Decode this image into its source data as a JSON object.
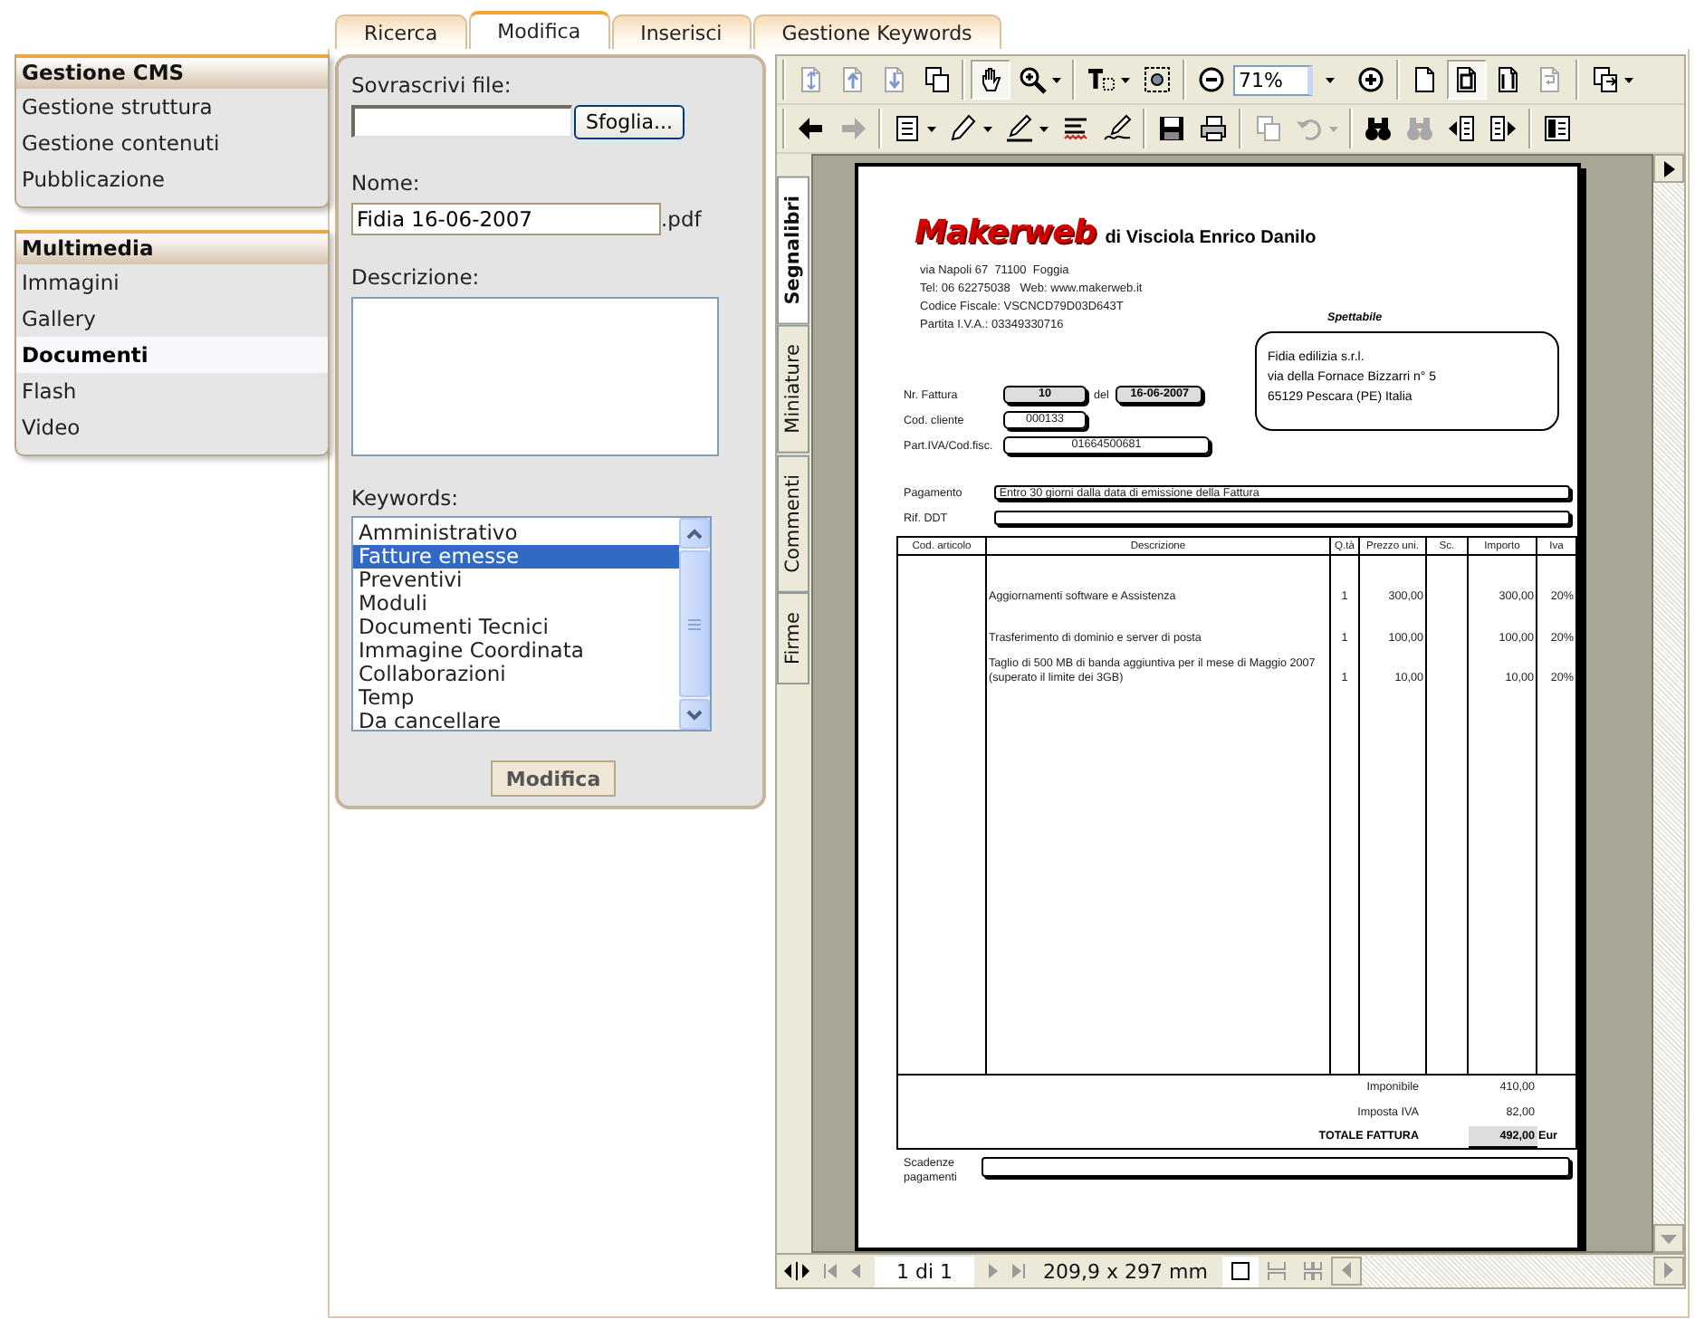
{
  "tabs": [
    {
      "label": "Ricerca",
      "selected": false
    },
    {
      "label": "Modifica",
      "selected": true
    },
    {
      "label": "Inserisci",
      "selected": false
    },
    {
      "label": "Gestione Keywords",
      "selected": false
    }
  ],
  "sidebar": [
    {
      "title": "Gestione CMS",
      "items": [
        {
          "label": "Gestione struttura",
          "selected": false
        },
        {
          "label": "Gestione contenuti",
          "selected": false
        },
        {
          "label": "Pubblicazione",
          "selected": false
        }
      ]
    },
    {
      "title": "Multimedia",
      "items": [
        {
          "label": "Immagini",
          "selected": false
        },
        {
          "label": "Gallery",
          "selected": false
        },
        {
          "label": "Documenti",
          "selected": true
        },
        {
          "label": "Flash",
          "selected": false
        },
        {
          "label": "Video",
          "selected": false
        }
      ]
    }
  ],
  "form": {
    "file_label": "Sovrascrivi file:",
    "browse_button": "Sfoglia...",
    "name_label": "Nome:",
    "name_value": "Fidia 16-06-2007",
    "name_suffix": ".pdf",
    "description_label": "Descrizione:",
    "keywords_label": "Keywords:",
    "keywords": [
      {
        "label": "Amministrativo",
        "selected": false
      },
      {
        "label": "Fatture emesse",
        "selected": true
      },
      {
        "label": "Preventivi",
        "selected": false
      },
      {
        "label": "Moduli",
        "selected": false
      },
      {
        "label": "Documenti Tecnici",
        "selected": false
      },
      {
        "label": "Immagine Coordinata",
        "selected": false
      },
      {
        "label": "Collaborazioni",
        "selected": false
      },
      {
        "label": "Temp",
        "selected": false
      },
      {
        "label": "Da cancellare",
        "selected": false
      }
    ],
    "submit_button": "Modifica"
  },
  "viewer": {
    "toolbar": [
      {
        "groups": [
          [
            {
              "kind": "scroll",
              "selected": false,
              "disabled": true,
              "menu": false
            },
            {
              "kind": "pageup",
              "selected": false,
              "disabled": true,
              "menu": false
            },
            {
              "kind": "pagedown",
              "selected": false,
              "disabled": true,
              "menu": false
            },
            {
              "kind": "pages",
              "selected": false,
              "disabled": false,
              "menu": false
            }
          ],
          [
            {
              "kind": "hand",
              "selected": true,
              "disabled": false,
              "menu": false
            },
            {
              "kind": "zoomtool",
              "selected": false,
              "disabled": false,
              "menu": true
            }
          ],
          [
            {
              "kind": "textselect",
              "selected": false,
              "disabled": false,
              "menu": true
            },
            {
              "kind": "snapshot",
              "selected": false,
              "disabled": false,
              "menu": false
            }
          ],
          [
            {
              "kind": "zoomout",
              "selected": false,
              "disabled": false,
              "menu": false
            },
            {
              "kind": "zoomfield",
              "selected": false,
              "disabled": false,
              "menu": true,
              "value": "71%"
            },
            {
              "kind": "zoomin",
              "selected": false,
              "disabled": false,
              "menu": false
            }
          ],
          [
            {
              "kind": "page",
              "selected": false,
              "disabled": false,
              "menu": false
            },
            {
              "kind": "fitpage",
              "selected": true,
              "disabled": false,
              "menu": false
            },
            {
              "kind": "fitwidth",
              "selected": false,
              "disabled": false,
              "menu": false
            },
            {
              "kind": "reflow",
              "selected": false,
              "disabled": true,
              "menu": false
            }
          ],
          [
            {
              "kind": "export",
              "selected": false,
              "disabled": false,
              "menu": true
            }
          ]
        ]
      },
      {
        "groups": [
          [
            {
              "kind": "back",
              "selected": false,
              "disabled": false,
              "menu": false
            },
            {
              "kind": "forward",
              "selected": false,
              "disabled": true,
              "menu": false
            }
          ],
          [
            {
              "kind": "note",
              "selected": false,
              "disabled": false,
              "menu": true
            },
            {
              "kind": "pencil",
              "selected": false,
              "disabled": false,
              "menu": true
            },
            {
              "kind": "highlight",
              "selected": false,
              "disabled": false,
              "menu": true
            },
            {
              "kind": "spell",
              "selected": false,
              "disabled": false,
              "menu": false
            },
            {
              "kind": "sign",
              "selected": false,
              "disabled": false,
              "menu": false
            }
          ],
          [
            {
              "kind": "save",
              "selected": false,
              "disabled": false,
              "menu": false
            },
            {
              "kind": "print",
              "selected": false,
              "disabled": false,
              "menu": false
            }
          ],
          [
            {
              "kind": "copy",
              "selected": false,
              "disabled": true,
              "menu": false
            },
            {
              "kind": "undo",
              "selected": false,
              "disabled": true,
              "menu": true
            }
          ],
          [
            {
              "kind": "find",
              "selected": false,
              "disabled": false,
              "menu": false
            },
            {
              "kind": "replace",
              "selected": false,
              "disabled": true,
              "menu": false
            },
            {
              "kind": "prevdoc",
              "selected": false,
              "disabled": false,
              "menu": false
            },
            {
              "kind": "nextdoc",
              "selected": false,
              "disabled": false,
              "menu": false
            }
          ],
          [
            {
              "kind": "panel",
              "selected": false,
              "disabled": false,
              "menu": false
            }
          ]
        ]
      }
    ],
    "side_tabs": [
      {
        "label": "Segnalibri",
        "selected": true
      },
      {
        "label": "Miniature",
        "selected": false
      },
      {
        "label": "Commenti",
        "selected": false
      },
      {
        "label": "Firme",
        "selected": false
      }
    ],
    "page_indicator": "1 di 1",
    "page_size": "209,9 x 297 mm",
    "document": {
      "logo": "Makerweb",
      "company": "di Visciola Enrico Danilo",
      "address": [
        "via Napoli 67  71100  Foggia",
        "Tel: 06 62275038   Web: www.makerweb.it",
        "Codice Fiscale: VSCNCD79D03D643T",
        "Partita I.V.A.: 03349330716"
      ],
      "recipient_heading": "Spettabile",
      "recipient": [
        "Fidia edilizia s.r.l.",
        "via della Fornace Bizzarri  n° 5",
        "65129 Pescara (PE) Italia"
      ],
      "invoice_number_label": "Nr. Fattura",
      "invoice_number": "10",
      "date_prefix": "del",
      "date": "16-06-2007",
      "client_code_label": "Cod. cliente",
      "client_code": "000133",
      "vat_number_label": "Part.IVA/Cod.fisc.",
      "vat_number": "01664500681",
      "payment_label": "Pagamento",
      "payment": "Entro 30 giorni dalla data di emissione della Fattura",
      "ddt_label": "Rif. DDT",
      "table": {
        "columns": [
          "Cod. articolo",
          "Descrizione",
          "Q.tà",
          "Prezzo uni.",
          "Sc.",
          "Importo",
          "Iva"
        ],
        "rows": [
          {
            "description": "Aggiornamenti software e Assistenza",
            "quantity": "1",
            "unit_price": "300,00",
            "amount": "300,00",
            "vat": "20%"
          },
          {
            "description": "Trasferimento di dominio e server di posta",
            "quantity": "1",
            "unit_price": "100,00",
            "amount": "100,00",
            "vat": "20%"
          },
          {
            "description": "Taglio di 500 MB di banda aggiuntiva per il mese di Maggio 2007 (superato il limite dei 3GB)",
            "quantity": "1",
            "unit_price": "10,00",
            "amount": "10,00",
            "vat": "20%"
          }
        ]
      },
      "totals": [
        {
          "kind": "subtotal",
          "label": "Imponibile",
          "value": "410,00"
        },
        {
          "kind": "subtotal",
          "label": "Imposta IVA",
          "value": "82,00"
        },
        {
          "kind": "total",
          "label": "TOTALE FATTURA",
          "value": "492,00",
          "currency": "Eur"
        }
      ],
      "due_label": "Scadenze pagamenti"
    }
  }
}
